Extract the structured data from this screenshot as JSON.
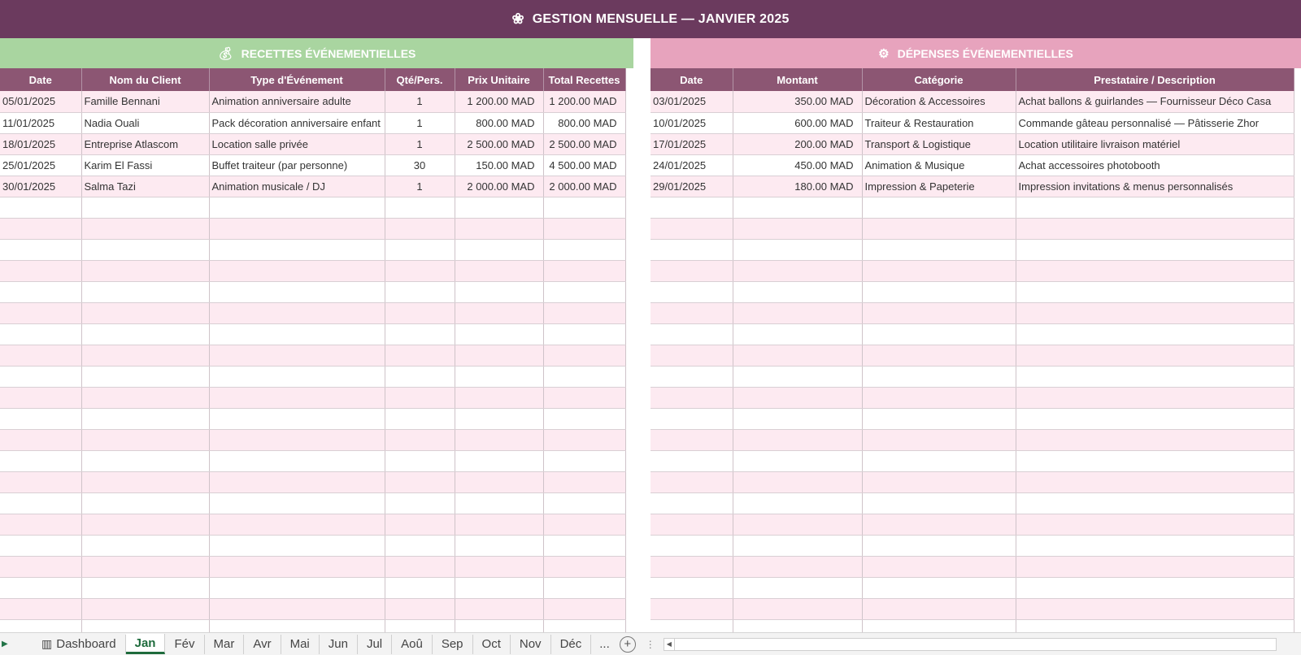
{
  "header": {
    "icon": "flower-icon",
    "title": "GESTION MENSUELLE — JANVIER 2025"
  },
  "recettes": {
    "title": "RECETTES ÉVÉNEMENTIELLES",
    "icon": "money-bag-icon",
    "columns": [
      "Date",
      "Nom du Client",
      "Type d'Événement",
      "Qté/Pers.",
      "Prix Unitaire",
      "Total Recettes"
    ],
    "rows": [
      [
        "05/01/2025",
        "Famille Bennani",
        "Animation anniversaire adulte",
        "1",
        "1 200.00 MAD",
        "1 200.00 MAD"
      ],
      [
        "11/01/2025",
        "Nadia Ouali",
        "Pack décoration anniversaire enfant",
        "1",
        "800.00 MAD",
        "800.00 MAD"
      ],
      [
        "18/01/2025",
        "Entreprise Atlascom",
        "Location salle privée",
        "1",
        "2 500.00 MAD",
        "2 500.00 MAD"
      ],
      [
        "25/01/2025",
        "Karim El Fassi",
        "Buffet traiteur (par personne)",
        "30",
        "150.00 MAD",
        "4 500.00 MAD"
      ],
      [
        "30/01/2025",
        "Salma Tazi",
        "Animation musicale / DJ",
        "1",
        "2 000.00 MAD",
        "2 000.00 MAD"
      ]
    ]
  },
  "depenses": {
    "title": "DÉPENSES ÉVÉNEMENTIELLES",
    "icon": "gear-icon",
    "columns": [
      "Date",
      "Montant",
      "Catégorie",
      "Prestataire / Description"
    ],
    "rows": [
      [
        "03/01/2025",
        "350.00 MAD",
        "Décoration & Accessoires",
        "Achat ballons & guirlandes — Fournisseur Déco Casa"
      ],
      [
        "10/01/2025",
        "600.00 MAD",
        "Traiteur & Restauration",
        "Commande gâteau personnalisé — Pâtisserie Zhor"
      ],
      [
        "17/01/2025",
        "200.00 MAD",
        "Transport & Logistique",
        "Location utilitaire livraison matériel"
      ],
      [
        "24/01/2025",
        "450.00 MAD",
        "Animation & Musique",
        "Achat accessoires photobooth"
      ],
      [
        "29/01/2025",
        "180.00 MAD",
        "Impression & Papeterie",
        "Impression invitations & menus personnalisés"
      ]
    ]
  },
  "sheet_tabs": [
    "Dashboard",
    "Jan",
    "Fév",
    "Mar",
    "Avr",
    "Mai",
    "Jun",
    "Jul",
    "Aoû",
    "Sep",
    "Oct",
    "Nov",
    "Déc"
  ],
  "active_tab": "Jan",
  "tabs_more": "...",
  "colors": {
    "header": "#6b3a5e",
    "recettes_head": "#a9d5a0",
    "depenses_head": "#e7a3bd",
    "column_head": "#8c5673",
    "row_alt": "#fdeaf1",
    "active_tab": "#1e6b3c"
  }
}
